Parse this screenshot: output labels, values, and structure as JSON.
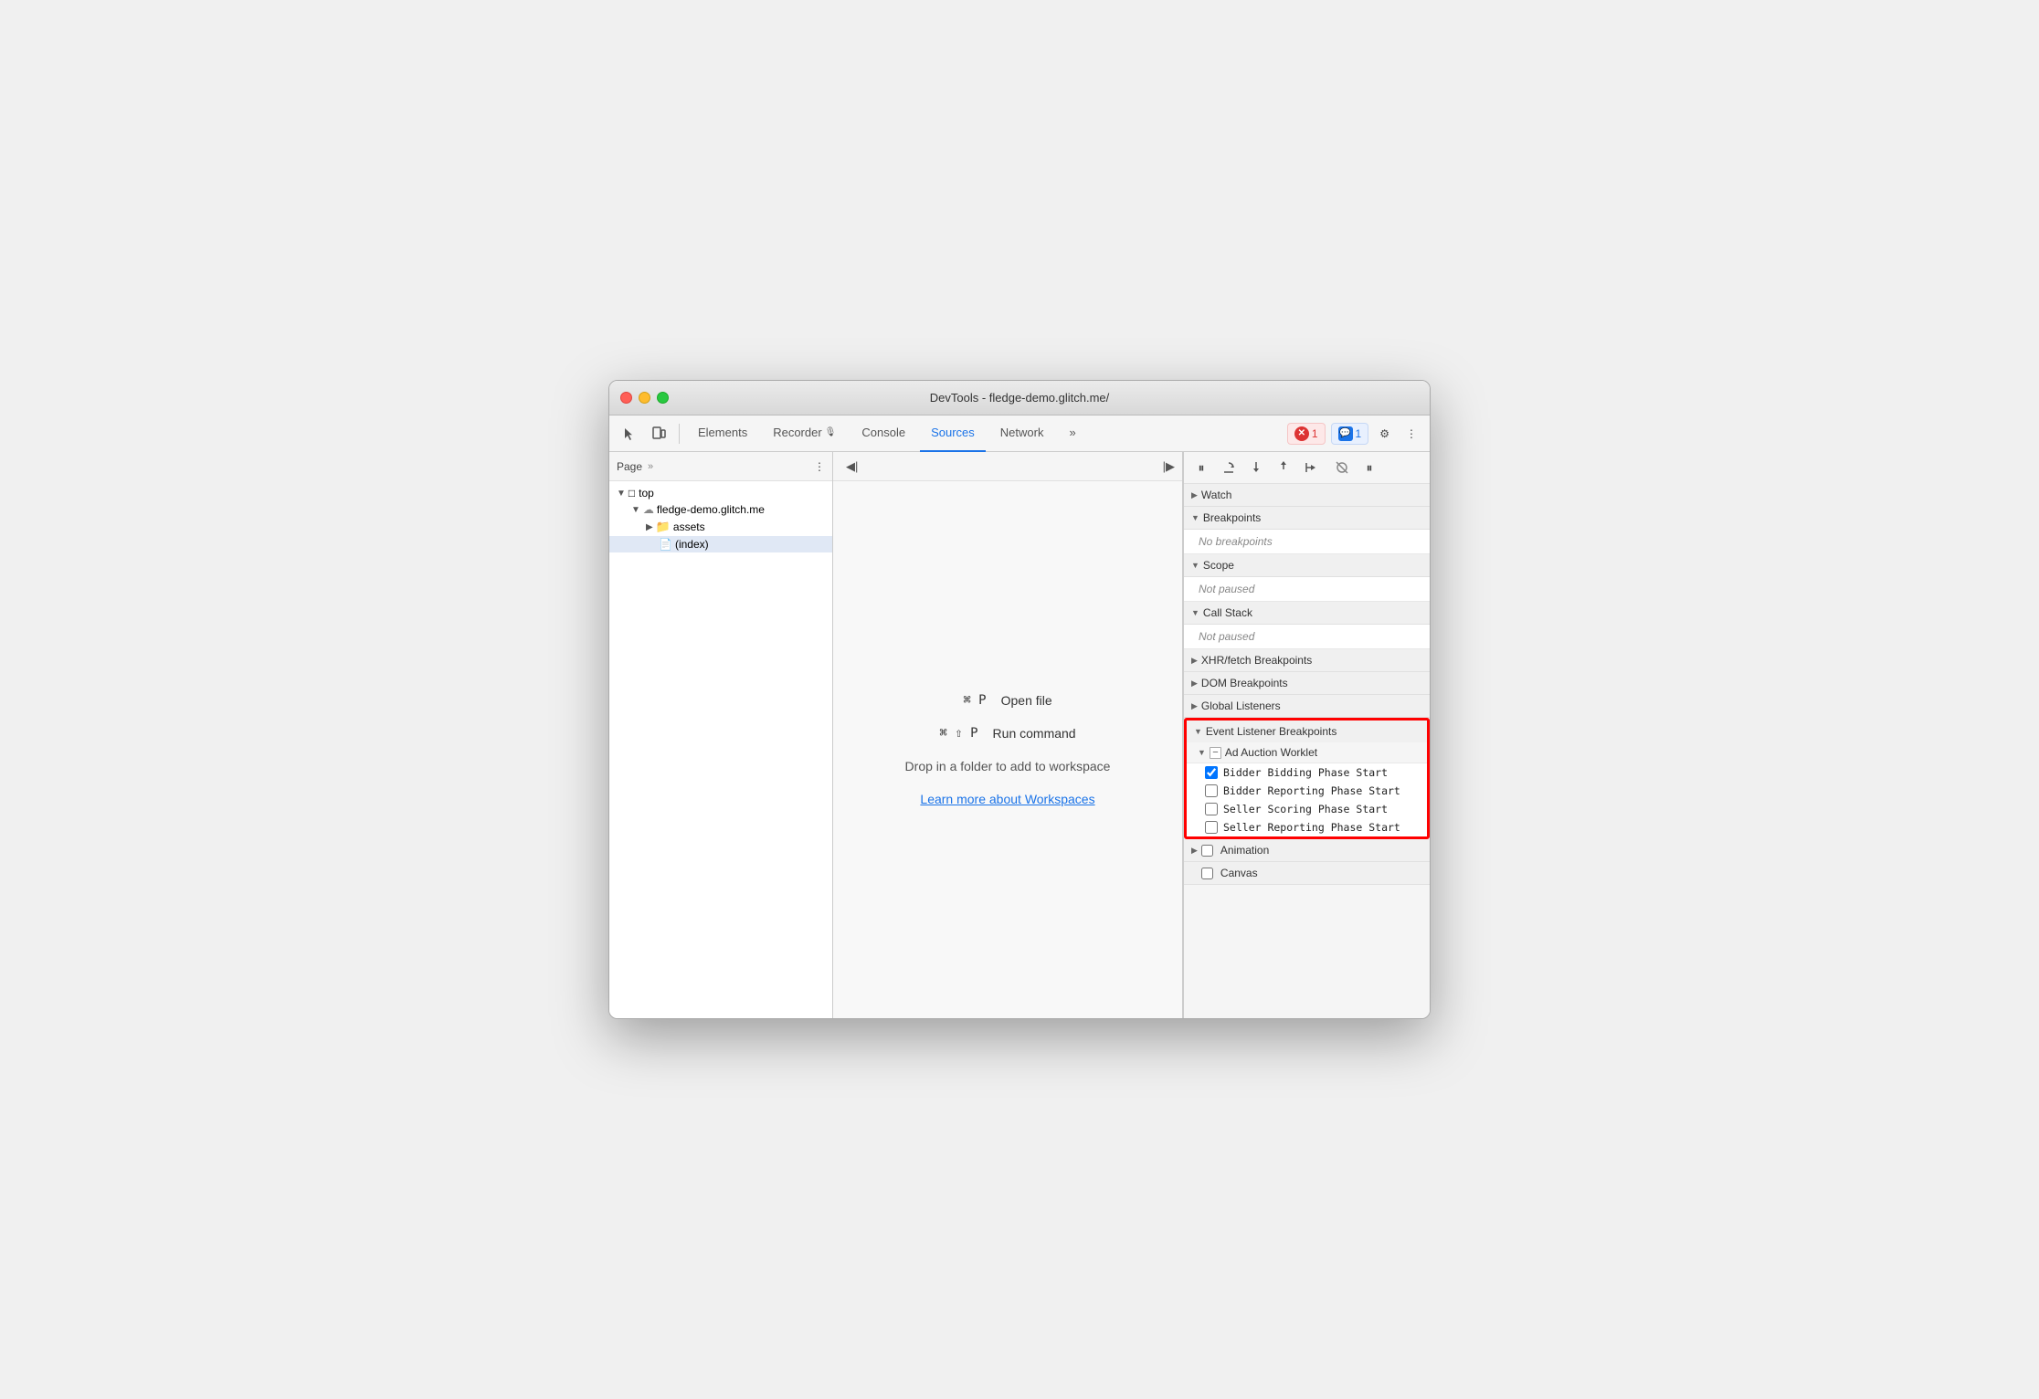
{
  "window": {
    "title": "DevTools - fledge-demo.glitch.me/"
  },
  "toolbar": {
    "tabs": [
      {
        "id": "elements",
        "label": "Elements",
        "active": false
      },
      {
        "id": "recorder",
        "label": "Recorder",
        "active": false
      },
      {
        "id": "console",
        "label": "Console",
        "active": false
      },
      {
        "id": "sources",
        "label": "Sources",
        "active": true
      },
      {
        "id": "network",
        "label": "Network",
        "active": false
      }
    ],
    "more_tabs_label": "»",
    "errors_count": "1",
    "messages_count": "1",
    "settings_icon": "⚙",
    "more_icon": "⋮"
  },
  "left_panel": {
    "page_label": "Page",
    "more_icon": "»",
    "three_dots": "⋮",
    "tree": [
      {
        "id": "top",
        "label": "top",
        "level": 0,
        "type": "root",
        "arrow": "▼"
      },
      {
        "id": "fledge",
        "label": "fledge-demo.glitch.me",
        "level": 1,
        "type": "cloud",
        "arrow": "▼"
      },
      {
        "id": "assets",
        "label": "assets",
        "level": 2,
        "type": "folder",
        "arrow": "▶"
      },
      {
        "id": "index",
        "label": "(index)",
        "level": 2,
        "type": "file",
        "selected": true
      }
    ]
  },
  "center_panel": {
    "left_panel_icon": "◀|",
    "right_panel_icon": "|▶",
    "shortcut1": {
      "keys": "⌘ P",
      "label": "Open file"
    },
    "shortcut2": {
      "keys": "⌘ ⇧ P",
      "label": "Run command"
    },
    "drop_hint": "Drop in a folder to add to workspace",
    "workspace_link": "Learn more about Workspaces"
  },
  "right_panel": {
    "debugger_buttons": [
      {
        "id": "pause",
        "icon": "⏸",
        "label": "pause"
      },
      {
        "id": "step-over",
        "icon": "↺",
        "label": "step-over"
      },
      {
        "id": "step-into",
        "icon": "↓",
        "label": "step-into"
      },
      {
        "id": "step-out",
        "icon": "↑",
        "label": "step-out"
      },
      {
        "id": "step",
        "icon": "→",
        "label": "step"
      },
      {
        "id": "deactivate",
        "icon": "⚡",
        "label": "deactivate"
      },
      {
        "id": "dont-pause",
        "icon": "⏸",
        "label": "dont-pause-exceptions"
      }
    ],
    "sections": [
      {
        "id": "watch",
        "label": "Watch",
        "collapsed": true,
        "arrow": "▶"
      },
      {
        "id": "breakpoints",
        "label": "Breakpoints",
        "collapsed": false,
        "arrow": "▼",
        "empty_text": "No breakpoints"
      },
      {
        "id": "scope",
        "label": "Scope",
        "collapsed": false,
        "arrow": "▼",
        "empty_text": "Not paused"
      },
      {
        "id": "call-stack",
        "label": "Call Stack",
        "collapsed": false,
        "arrow": "▼",
        "empty_text": "Not paused"
      },
      {
        "id": "xhr-breakpoints",
        "label": "XHR/fetch Breakpoints",
        "collapsed": true,
        "arrow": "▶"
      },
      {
        "id": "dom-breakpoints",
        "label": "DOM Breakpoints",
        "collapsed": true,
        "arrow": "▶"
      },
      {
        "id": "global-listeners",
        "label": "Global Listeners",
        "collapsed": true,
        "arrow": "▶"
      }
    ],
    "event_listener_section": {
      "id": "event-listener-breakpoints",
      "label": "Event Listener Breakpoints",
      "arrow": "▼",
      "sub_sections": [
        {
          "id": "ad-auction-worklet",
          "label": "Ad Auction Worklet",
          "arrow": "▼",
          "items": [
            {
              "id": "bidder-bidding",
              "label": "Bidder Bidding Phase Start",
              "checked": true
            },
            {
              "id": "bidder-reporting",
              "label": "Bidder Reporting Phase Start",
              "checked": false
            },
            {
              "id": "seller-scoring",
              "label": "Seller Scoring Phase Start",
              "checked": false
            },
            {
              "id": "seller-reporting",
              "label": "Seller Reporting Phase Start",
              "checked": false
            }
          ]
        }
      ]
    },
    "animation_section": {
      "label": "Animation",
      "arrow": "▶"
    },
    "canvas_section": {
      "label": "Canvas",
      "arrow": "▶"
    }
  }
}
